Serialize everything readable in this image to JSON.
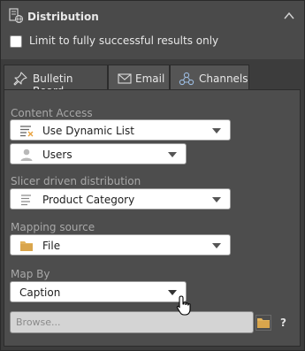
{
  "header": {
    "title": "Distribution"
  },
  "limit": {
    "label": "Limit to fully successful results only",
    "checked": false
  },
  "tabs": [
    {
      "label": "Bulletin Board",
      "icon": "pin-icon",
      "active": true
    },
    {
      "label": "Email",
      "icon": "envelope-icon",
      "active": false
    },
    {
      "label": "Channels",
      "icon": "channels-icon",
      "active": false
    }
  ],
  "content_access": {
    "label": "Content Access",
    "list_value": "Use Dynamic List",
    "users_value": "Users"
  },
  "slicer": {
    "label": "Slicer driven distribution",
    "value": "Product Category"
  },
  "mapping": {
    "label": "Mapping source",
    "value": "File"
  },
  "map_by": {
    "label": "Map By",
    "value": "Caption"
  },
  "browse": {
    "placeholder": "Browse..."
  },
  "help": {
    "label": "?"
  },
  "colors": {
    "background": "#3c3c3c",
    "header": "#4a4a4a",
    "content": "#4d4d4d",
    "folder": "#e2b35c"
  }
}
